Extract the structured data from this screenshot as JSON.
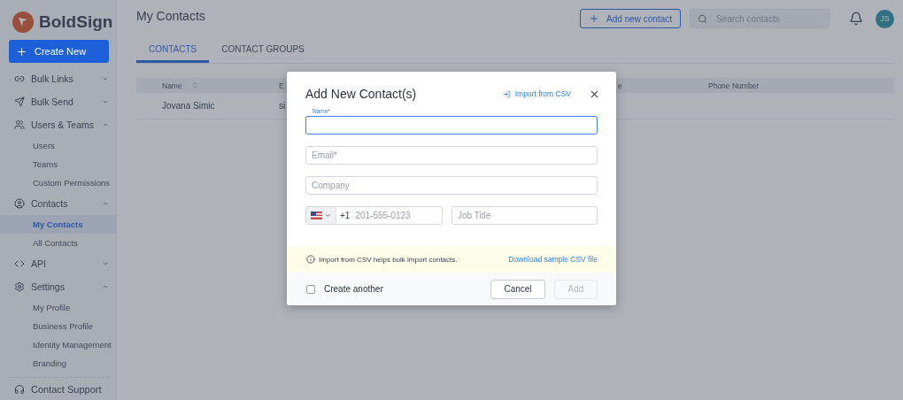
{
  "brand": {
    "name": "BoldSign"
  },
  "create_button": {
    "label": "Create New"
  },
  "sidebar": {
    "items": [
      {
        "label": "Bulk Links",
        "expanded": false
      },
      {
        "label": "Bulk Send",
        "expanded": false
      },
      {
        "label": "Users & Teams",
        "expanded": true,
        "children": [
          {
            "label": "Users",
            "selected": false
          },
          {
            "label": "Teams",
            "selected": false
          },
          {
            "label": "Custom Permissions",
            "selected": false
          }
        ]
      },
      {
        "label": "Contacts",
        "expanded": true,
        "children": [
          {
            "label": "My Contacts",
            "selected": true
          },
          {
            "label": "All Contacts",
            "selected": false
          }
        ]
      },
      {
        "label": "API",
        "expanded": false
      },
      {
        "label": "Settings",
        "expanded": true,
        "children": [
          {
            "label": "My Profile",
            "selected": false
          },
          {
            "label": "Business Profile",
            "selected": false
          },
          {
            "label": "Identity Management",
            "selected": false
          },
          {
            "label": "Branding",
            "selected": false
          }
        ]
      }
    ],
    "footer": "Contact Support"
  },
  "page": {
    "title": "My Contacts"
  },
  "header": {
    "add_button": "Add new contact",
    "search": {
      "placeholder": "Search contacts"
    },
    "avatar": "JS"
  },
  "tabs": [
    {
      "label": "CONTACTS",
      "selected": true
    },
    {
      "label": "CONTACT GROUPS",
      "selected": false
    }
  ],
  "table": {
    "columns": [
      "Name",
      "E",
      "e",
      "Phone Number"
    ],
    "rows": [
      [
        "Jovana Simic",
        "si"
      ]
    ]
  },
  "modal": {
    "title": "Add New Contact(s)",
    "import_link": "Import from CSV",
    "name_field": {
      "label": "Name*",
      "focused": true
    },
    "email_field": {
      "placeholder": "Email*"
    },
    "company_field": {
      "placeholder": "Company"
    },
    "phone_field": {
      "code": "+1",
      "placeholder": "201-555-0123"
    },
    "job_field": {
      "placeholder": "Job Title"
    },
    "info": "Import from CSV helps bulk import contacts.",
    "download_link": "Download sample CSV file",
    "create_another": {
      "label": "Create another",
      "checked": false
    },
    "cancel": "Cancel",
    "add": {
      "label": "Add",
      "disabled": true
    }
  }
}
